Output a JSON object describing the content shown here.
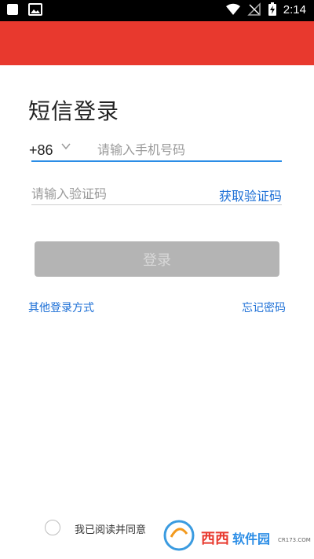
{
  "status_bar": {
    "time": "2:14",
    "left_icons": [
      "notification-icon",
      "image-icon"
    ],
    "right_icons": [
      "wifi-icon",
      "no-signal-icon",
      "battery-charging-icon"
    ]
  },
  "header": {
    "color": "#e8392e"
  },
  "login": {
    "title": "短信登录",
    "country_code": "+86",
    "phone_placeholder": "请输入手机号码",
    "code_placeholder": "请输入验证码",
    "get_code_label": "获取验证码",
    "login_button_label": "登录",
    "other_login_label": "其他登录方式",
    "forgot_password_label": "忘记密码",
    "agreement_text": "我已阅读并同意"
  },
  "watermark": {
    "brand_text": "西西软件园",
    "url_text": "CR173.COM"
  },
  "colors": {
    "accent_blue": "#2b8de6",
    "link_blue": "#1c6fd6",
    "button_disabled": "#b4b4b4"
  }
}
